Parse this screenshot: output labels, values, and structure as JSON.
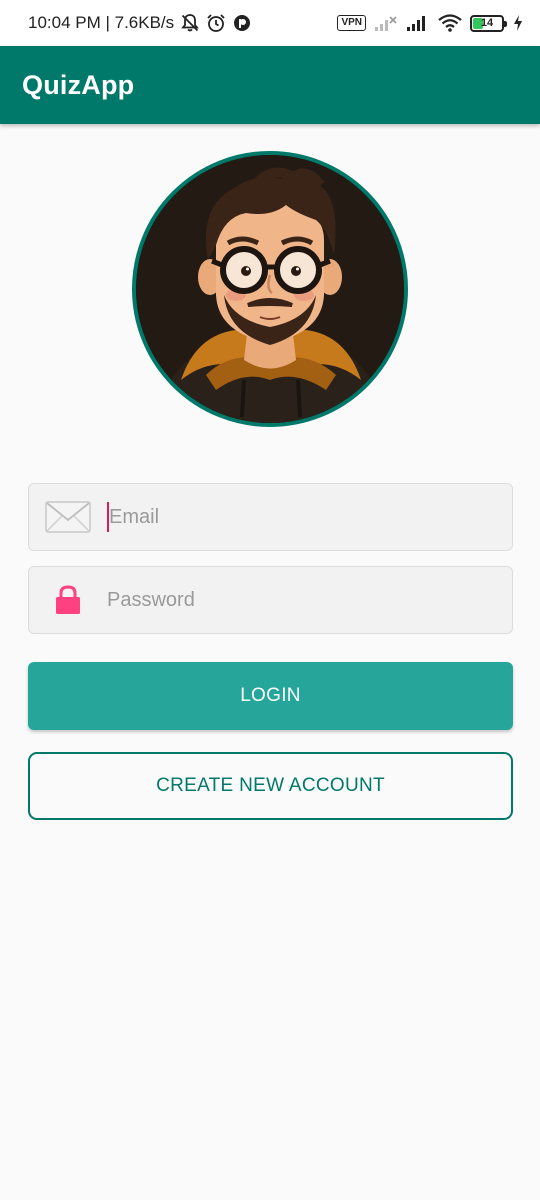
{
  "status_bar": {
    "time_speed": "10:04 PM | 7.6KB/s",
    "vpn": "VPN",
    "battery_level": "14",
    "icons": [
      "bell-off-icon",
      "alarm-icon",
      "app-notification-icon",
      "vpn-icon",
      "signal-no-service-icon",
      "signal-icon",
      "wifi-icon",
      "battery-icon",
      "charging-icon"
    ]
  },
  "app_bar": {
    "title": "QuizApp"
  },
  "login_form": {
    "email_placeholder": "Email",
    "password_placeholder": "Password",
    "login_label": "LOGIN",
    "create_account_label": "CREATE NEW ACCOUNT"
  },
  "colors": {
    "primary": "#00796b",
    "button": "#26a69a",
    "lock": "#ff4081",
    "caret": "#d81b60"
  }
}
